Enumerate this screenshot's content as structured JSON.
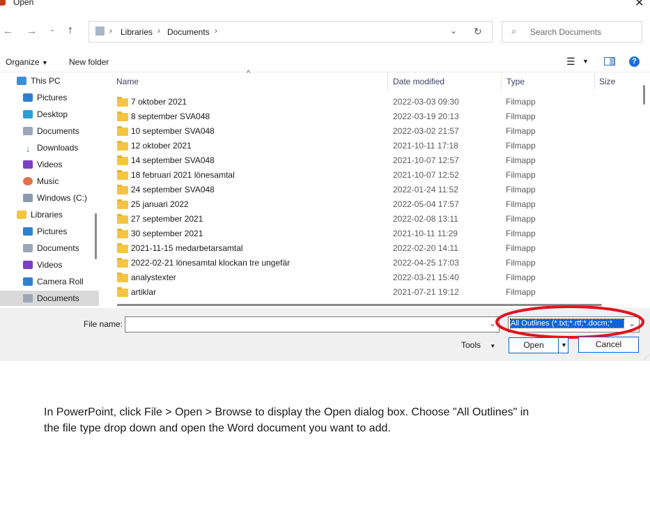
{
  "window": {
    "title": "Open"
  },
  "address": {
    "segments": [
      "Libraries",
      "Documents"
    ]
  },
  "search": {
    "placeholder": "Search Documents"
  },
  "toolbar": {
    "organize": "Organize",
    "new_folder": "New folder"
  },
  "sidebar": {
    "items": [
      {
        "label": "This PC",
        "icon": "computer-icon"
      },
      {
        "label": "Pictures",
        "icon": "pictures-icon"
      },
      {
        "label": "Desktop",
        "icon": "desktop-icon"
      },
      {
        "label": "Documents",
        "icon": "documents-icon"
      },
      {
        "label": "Downloads",
        "icon": "downloads-icon"
      },
      {
        "label": "Videos",
        "icon": "videos-icon"
      },
      {
        "label": "Music",
        "icon": "music-icon"
      },
      {
        "label": "Windows  (C:)",
        "icon": "drive-icon"
      },
      {
        "label": "Libraries",
        "icon": "libraries-icon"
      },
      {
        "label": "Pictures",
        "icon": "pictures-icon"
      },
      {
        "label": "Documents",
        "icon": "documents-icon"
      },
      {
        "label": "Videos",
        "icon": "videos-icon"
      },
      {
        "label": "Camera Roll",
        "icon": "camera-roll-icon"
      },
      {
        "label": "Documents",
        "icon": "documents-icon",
        "selected": true
      }
    ]
  },
  "columns": {
    "name": "Name",
    "date": "Date modified",
    "type": "Type",
    "size": "Size"
  },
  "files": [
    {
      "name": "7 oktober 2021",
      "date": "2022-03-03 09:30",
      "type": "Filmapp"
    },
    {
      "name": "8 september SVA048",
      "date": "2022-03-19 20:13",
      "type": "Filmapp"
    },
    {
      "name": "10 september SVA048",
      "date": "2022-03-02 21:57",
      "type": "Filmapp"
    },
    {
      "name": "12 oktober 2021",
      "date": "2021-10-11 17:18",
      "type": "Filmapp"
    },
    {
      "name": "14 september SVA048",
      "date": "2021-10-07 12:57",
      "type": "Filmapp"
    },
    {
      "name": "18 februari 2021 lönesamtal",
      "date": "2021-10-07 12:52",
      "type": "Filmapp"
    },
    {
      "name": "24 september SVA048",
      "date": "2022-01-24 11:52",
      "type": "Filmapp"
    },
    {
      "name": "25 januari 2022",
      "date": "2022-05-04 17:57",
      "type": "Filmapp"
    },
    {
      "name": "27 september 2021",
      "date": "2022-02-08 13:11",
      "type": "Filmapp"
    },
    {
      "name": "30 september 2021",
      "date": "2021-10-11 11:29",
      "type": "Filmapp"
    },
    {
      "name": "2021-11-15 medarbetarsamtal",
      "date": "2022-02-20 14:11",
      "type": "Filmapp"
    },
    {
      "name": "2022-02-21 lönesamtal klockan tre ungefär",
      "date": "2022-04-25 17:03",
      "type": "Filmapp"
    },
    {
      "name": "analystexter",
      "date": "2022-03-21 15:40",
      "type": "Filmapp"
    },
    {
      "name": "artiklar",
      "date": "2021-07-21 19:12",
      "type": "Filmapp"
    }
  ],
  "bottom": {
    "filename_label": "File name:",
    "filename_value": "",
    "filetype_value": "All Outlines (*.txt;*.rtf;*.docm;*",
    "tools": "Tools",
    "open": "Open",
    "cancel": "Cancel"
  },
  "caption": "In PowerPoint, click File > Open > Browse to display the Open dialog box. Choose \"All Outlines\" in the file type drop down and open the Word document you want to add.",
  "colors": {
    "accent": "#0a64d6",
    "highlight_circle": "#e0141e",
    "folder": "#f5c542",
    "selected_bg": "#d9d9d9"
  }
}
